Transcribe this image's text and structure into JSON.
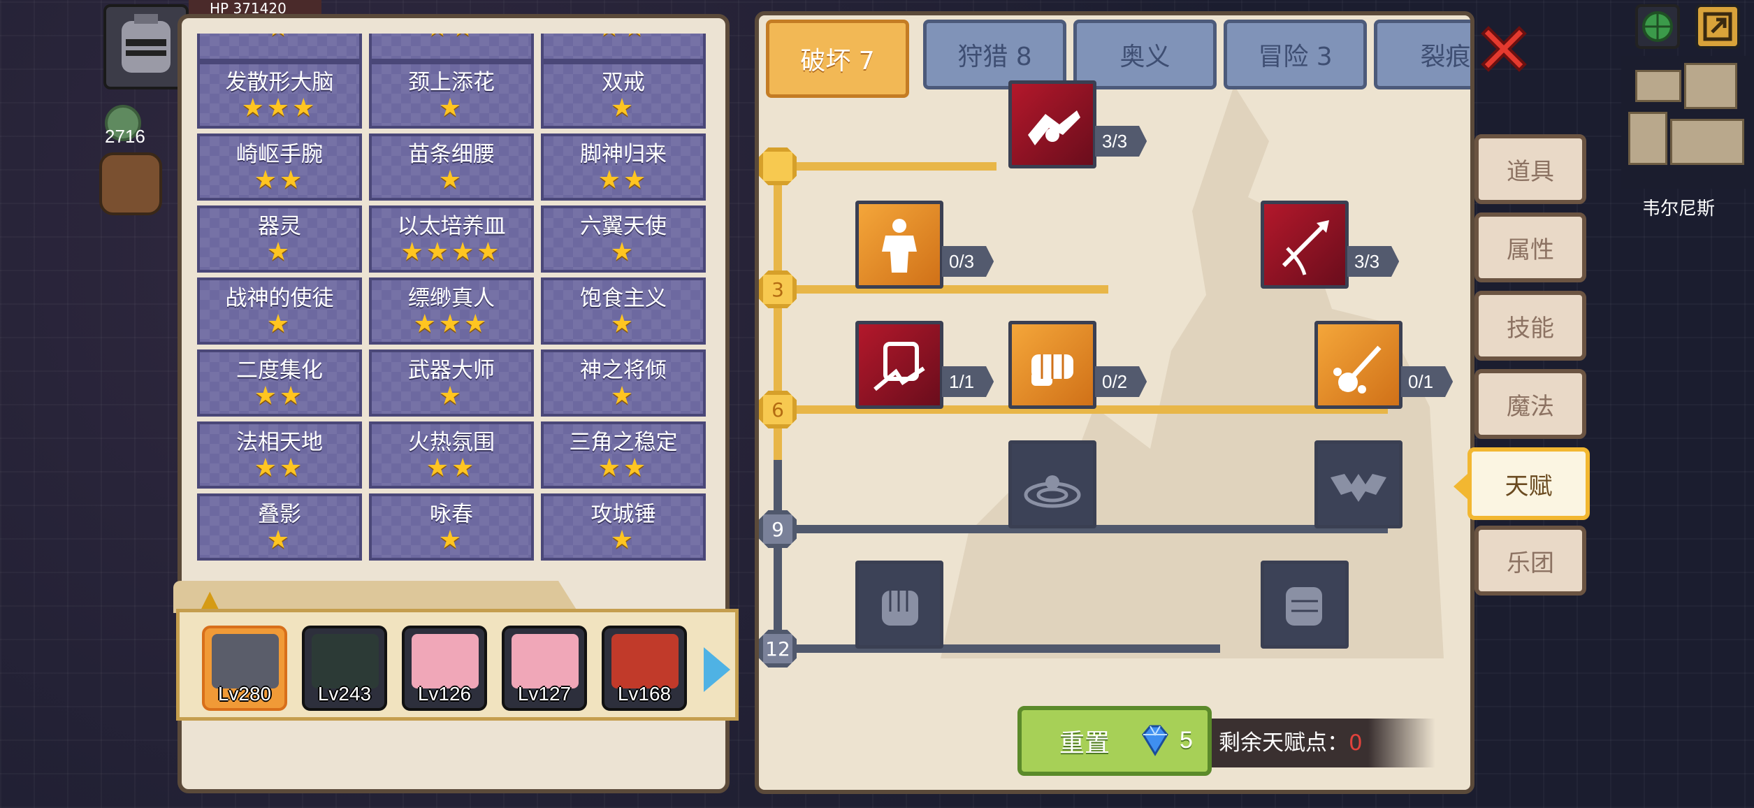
{
  "hud": {
    "hp_label": "HP",
    "hp_value": "371420",
    "gems": "2716",
    "location": "韦尔尼斯"
  },
  "talent_list": [
    {
      "name": "",
      "stars": 1
    },
    {
      "name": "",
      "stars": 2
    },
    {
      "name": "",
      "stars": 2
    },
    {
      "name": "发散形大脑",
      "stars": 3
    },
    {
      "name": "颈上添花",
      "stars": 1
    },
    {
      "name": "双戒",
      "stars": 1
    },
    {
      "name": "崎岖手腕",
      "stars": 2
    },
    {
      "name": "苗条细腰",
      "stars": 1
    },
    {
      "name": "脚神归来",
      "stars": 2
    },
    {
      "name": "器灵",
      "stars": 1
    },
    {
      "name": "以太培养皿",
      "stars": 4
    },
    {
      "name": "六翼天使",
      "stars": 1
    },
    {
      "name": "战神的使徒",
      "stars": 1
    },
    {
      "name": "缥缈真人",
      "stars": 3
    },
    {
      "name": "饱食主义",
      "stars": 1
    },
    {
      "name": "二度集化",
      "stars": 2
    },
    {
      "name": "武器大师",
      "stars": 1
    },
    {
      "name": "神之将倾",
      "stars": 1
    },
    {
      "name": "法相天地",
      "stars": 2
    },
    {
      "name": "火热氛围",
      "stars": 2
    },
    {
      "name": "三角之稳定",
      "stars": 2
    },
    {
      "name": "叠影",
      "stars": 1
    },
    {
      "name": "咏春",
      "stars": 1
    },
    {
      "name": "攻城锤",
      "stars": 1
    }
  ],
  "heroes": [
    {
      "level": "Lv280",
      "selected": true,
      "color": "#5a5d6a"
    },
    {
      "level": "Lv243",
      "selected": false,
      "color": "#2c3a36"
    },
    {
      "level": "Lv126",
      "selected": false,
      "color": "#f0a7b8"
    },
    {
      "level": "Lv127",
      "selected": false,
      "color": "#f0a7b8"
    },
    {
      "level": "Lv168",
      "selected": false,
      "color": "#c13a2a"
    }
  ],
  "tabs": [
    {
      "label": "破坏 7",
      "active": true
    },
    {
      "label": "狩猎 8",
      "active": false
    },
    {
      "label": "奥义",
      "active": false
    },
    {
      "label": "冒险 3",
      "active": false
    },
    {
      "label": "裂痕",
      "active": false
    }
  ],
  "tree": {
    "levels": [
      "",
      "3",
      "6",
      "9",
      "12"
    ],
    "skills": [
      {
        "id": "arm-wrestle",
        "icon": "handshake-icon",
        "style": "red",
        "count": "3/3"
      },
      {
        "id": "muscle",
        "icon": "body-icon",
        "style": "orange",
        "count": "0/3"
      },
      {
        "id": "arrow-hit",
        "icon": "arrow-icon",
        "style": "red",
        "count": "3/3"
      },
      {
        "id": "shatter",
        "icon": "shatter-icon",
        "style": "red",
        "count": "1/1"
      },
      {
        "id": "punch",
        "icon": "punch-icon",
        "style": "orange",
        "count": "0/2"
      },
      {
        "id": "splash",
        "icon": "splash-icon",
        "style": "orange",
        "count": "0/1"
      },
      {
        "id": "ripple",
        "icon": "ripple-icon",
        "style": "locked",
        "count": ""
      },
      {
        "id": "bat-drop",
        "icon": "bat-icon",
        "style": "locked",
        "count": ""
      },
      {
        "id": "fist",
        "icon": "fist-icon",
        "style": "locked",
        "count": ""
      },
      {
        "id": "fist-back",
        "icon": "fist-back-icon",
        "style": "locked",
        "count": ""
      }
    ]
  },
  "reset": {
    "label": "重置",
    "cost": "5"
  },
  "remaining": {
    "label": "剩余天赋点：",
    "value": "0"
  },
  "menu": [
    {
      "label": "道具",
      "active": false
    },
    {
      "label": "属性",
      "active": false
    },
    {
      "label": "技能",
      "active": false
    },
    {
      "label": "魔法",
      "active": false
    },
    {
      "label": "天赋",
      "active": true
    },
    {
      "label": "乐团",
      "active": false
    }
  ],
  "colors": {
    "accent": "#f2b855",
    "locked": "#3c4257",
    "talent_cell": "#6d69a0"
  }
}
